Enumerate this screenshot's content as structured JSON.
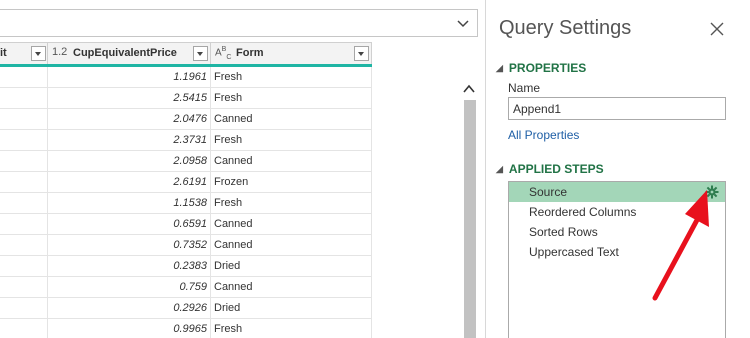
{
  "grid": {
    "columns": [
      {
        "type_icon": "",
        "name": "it"
      },
      {
        "type_icon": "1.2",
        "name": "CupEquivalentPrice"
      },
      {
        "type_icon": "ABC",
        "name": "Form"
      }
    ],
    "rows": [
      {
        "price": "1.1961",
        "form": "Fresh"
      },
      {
        "price": "2.5415",
        "form": "Fresh"
      },
      {
        "price": "2.0476",
        "form": "Canned"
      },
      {
        "price": "2.3731",
        "form": "Fresh"
      },
      {
        "price": "2.0958",
        "form": "Canned"
      },
      {
        "price": "2.6191",
        "form": "Frozen"
      },
      {
        "price": "1.1538",
        "form": "Fresh"
      },
      {
        "price": "0.6591",
        "form": "Canned"
      },
      {
        "price": "0.7352",
        "form": "Canned"
      },
      {
        "price": "0.2383",
        "form": "Dried"
      },
      {
        "price": "0.759",
        "form": "Canned"
      },
      {
        "price": "0.2926",
        "form": "Dried"
      },
      {
        "price": "0.9965",
        "form": "Fresh"
      }
    ]
  },
  "query_settings": {
    "title": "Query Settings",
    "properties_header": "PROPERTIES",
    "name_label": "Name",
    "name_value": "Append1",
    "all_properties_link": "All Properties",
    "applied_steps_header": "APPLIED STEPS",
    "steps": [
      {
        "label": "Source",
        "selected": true
      },
      {
        "label": "Reordered Columns",
        "selected": false
      },
      {
        "label": "Sorted Rows",
        "selected": false
      },
      {
        "label": "Uppercased Text",
        "selected": false
      }
    ]
  },
  "colors": {
    "accent_green": "#217346",
    "selected_step": "#a3d6b8",
    "column_quality_bar": "#1fb5a4",
    "annotation_arrow": "#e8111d"
  },
  "icons": [
    "chevron-down-icon",
    "filter-dropdown-icon",
    "scroll-up-icon",
    "close-icon",
    "collapse-triangle-icon",
    "gear-icon",
    "red-arrow-annotation"
  ]
}
